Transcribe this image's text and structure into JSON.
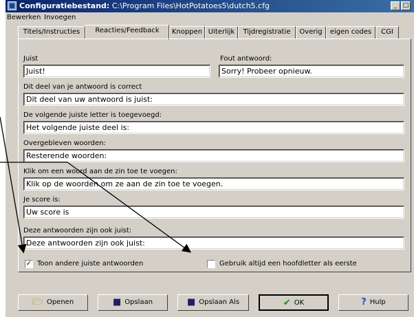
{
  "window": {
    "title_bold": "Configuratiebestand:",
    "title_path": " C:\\Program Files\\HotPotatoes5\\dutch5.cfg",
    "minimize": "_",
    "maximize": "□"
  },
  "menu": {
    "items": [
      {
        "label": "Bewerken"
      },
      {
        "label": "Invoegen"
      }
    ]
  },
  "tabs": [
    {
      "label": "Titels/Instructies"
    },
    {
      "label": "Reacties/Feedback"
    },
    {
      "label": "Knoppen"
    },
    {
      "label": "Uiterlijk"
    },
    {
      "label": "Tijdregistratie"
    },
    {
      "label": "Overig"
    },
    {
      "label": "eigen codes"
    },
    {
      "label": "CGI"
    }
  ],
  "active_tab": "Reacties/Feedback",
  "form": {
    "juist_label": "Juist",
    "juist_value": "Juist!",
    "fout_label": "Fout antwoord:",
    "fout_value": "Sorry! Probeer opnieuw.",
    "correct_part_label": "Dit deel van je antwoord is correct",
    "correct_part_value": "Dit deel van uw antwoord is juist:",
    "next_letter_label": "De volgende juiste letter is toegevoegd:",
    "next_letter_value": "Het volgende juiste deel is:",
    "remaining_label": "Overgebleven woorden:",
    "remaining_value": "Resterende woorden:",
    "click_word_label": "Klik om een woord aan de zin toe te voegen:",
    "click_word_value": "Klik op de woorden om ze aan de zin toe te voegen.",
    "score_label": "Je score is:",
    "score_value": "Uw score is",
    "also_correct_label": "Deze antwoorden zijn ook juist:",
    "also_correct_value": "Deze antwoorden zijn ook juist:",
    "show_other_label": "Toon andere juiste antwoorden",
    "show_other_checked": true,
    "capital_label": "Gebruik altijd een hoofdletter als eerste",
    "capital_checked": false
  },
  "buttons": {
    "open": "Openen",
    "save": "Opslaan",
    "save_as": "Opslaan Als",
    "ok": "OK",
    "help": "Hulp"
  },
  "icons": {
    "open": "folder-open-icon",
    "save": "floppy-disk-icon",
    "save_as": "floppy-disk-save-as-icon",
    "ok": "checkmark-icon",
    "help": "question-mark-icon"
  },
  "colors": {
    "window_bg": "#d4d0c8",
    "titlebar": "#0a246a",
    "ok_check": "#1e8a1e",
    "help_q": "#2050c0"
  }
}
